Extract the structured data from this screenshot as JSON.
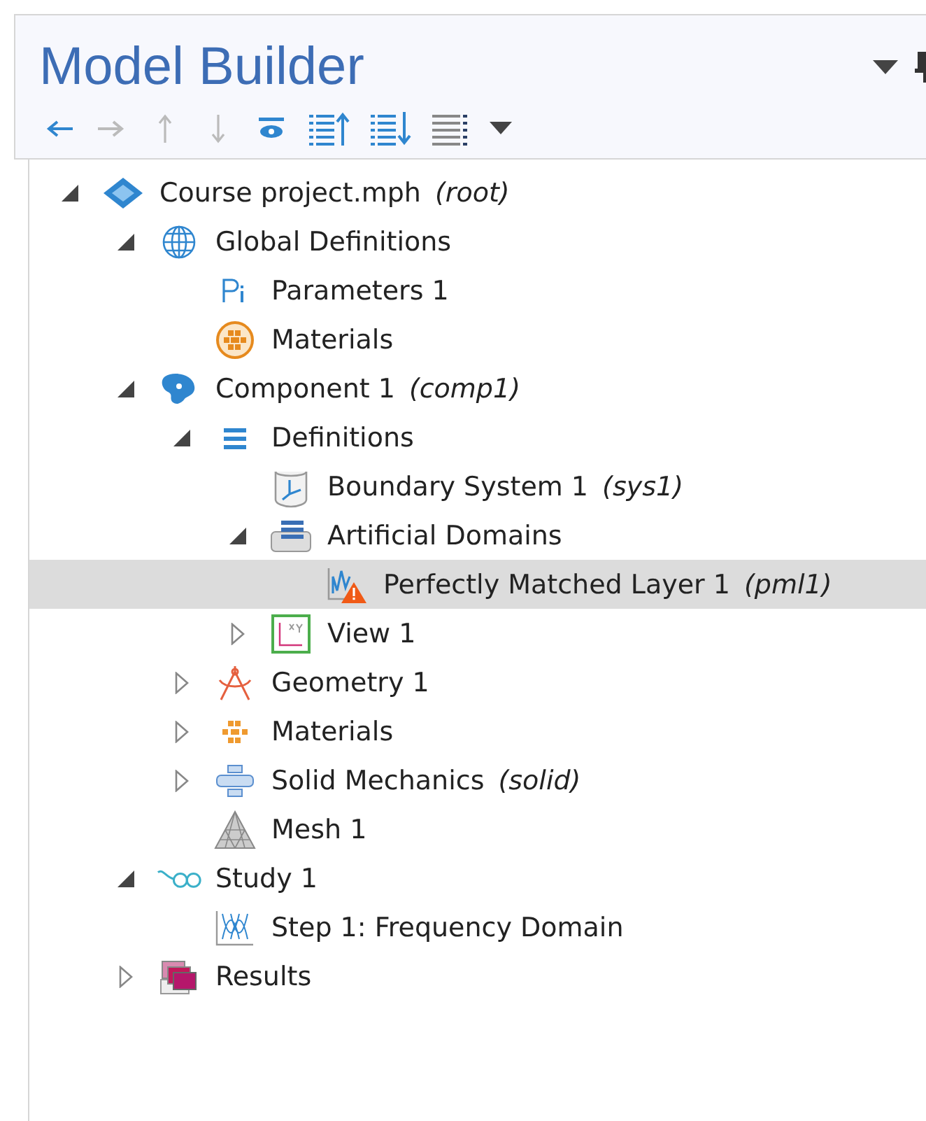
{
  "panel": {
    "title": "Model Builder"
  },
  "toolbar": [
    {
      "kind": "back",
      "disabled": false
    },
    {
      "kind": "forward",
      "disabled": true
    },
    {
      "kind": "up",
      "disabled": true
    },
    {
      "kind": "down",
      "disabled": true
    },
    {
      "kind": "show",
      "disabled": false
    },
    {
      "kind": "collapse",
      "disabled": false
    },
    {
      "kind": "expand",
      "disabled": false
    },
    {
      "kind": "list",
      "disabled": false
    },
    {
      "kind": "menu",
      "disabled": false
    }
  ],
  "tree": [
    {
      "label": "Course project.mph",
      "tag": "(root)",
      "kind": "model",
      "expanded": true,
      "selected": false,
      "children": [
        {
          "label": "Global Definitions",
          "kind": "globe",
          "expanded": true,
          "selected": false,
          "children": [
            {
              "label": "Parameters 1",
              "kind": "parameters",
              "selected": false
            },
            {
              "label": "Materials",
              "kind": "materials-ring",
              "selected": false
            }
          ]
        },
        {
          "label": "Component 1",
          "tag": "(comp1)",
          "kind": "component",
          "expanded": true,
          "selected": false,
          "children": [
            {
              "label": "Definitions",
              "kind": "definitions",
              "expanded": true,
              "selected": false,
              "children": [
                {
                  "label": "Boundary System 1",
                  "tag": "(sys1)",
                  "kind": "boundary-system",
                  "selected": false
                },
                {
                  "label": "Artificial Domains",
                  "kind": "artificial-domains",
                  "expanded": true,
                  "selected": false,
                  "children": [
                    {
                      "label": "Perfectly Matched Layer 1",
                      "tag": "(pml1)",
                      "kind": "pml",
                      "warning": true,
                      "selected": true
                    }
                  ]
                },
                {
                  "label": "View 1",
                  "kind": "view",
                  "expanded": false,
                  "selected": false
                }
              ]
            },
            {
              "label": "Geometry 1",
              "kind": "geometry",
              "expanded": false,
              "selected": false
            },
            {
              "label": "Materials",
              "kind": "materials",
              "expanded": false,
              "selected": false
            },
            {
              "label": "Solid Mechanics",
              "tag": "(solid)",
              "kind": "physics",
              "expanded": false,
              "selected": false
            },
            {
              "label": "Mesh 1",
              "kind": "mesh",
              "selected": false
            }
          ]
        },
        {
          "label": "Study 1",
          "kind": "study",
          "expanded": true,
          "selected": false,
          "children": [
            {
              "label": "Step 1: Frequency Domain",
              "kind": "step",
              "selected": false
            }
          ]
        },
        {
          "label": "Results",
          "kind": "results",
          "expanded": false,
          "selected": false
        }
      ]
    }
  ]
}
